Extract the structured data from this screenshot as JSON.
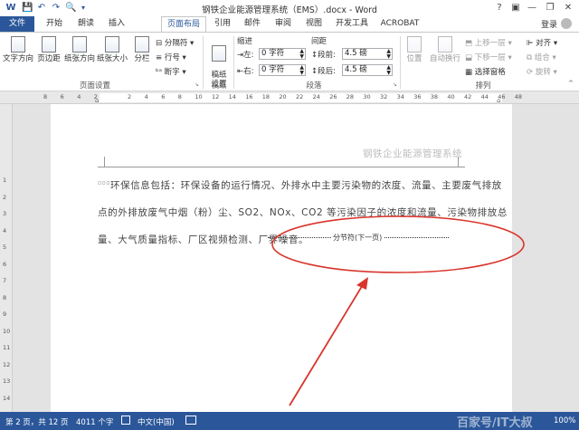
{
  "window": {
    "title": "钢铁企业能源管理系统（EMS）.docx - Word",
    "help": "?",
    "minimize": "—",
    "restore": "❐",
    "close": "✕"
  },
  "tabs": [
    "文件",
    "开始",
    "朗读",
    "插入",
    "页面布局",
    "引用",
    "邮件",
    "审阅",
    "视图",
    "开发工具",
    "ACROBAT"
  ],
  "active_tab": "页面布局",
  "account": {
    "login": "登录"
  },
  "ribbon": {
    "page_setup": {
      "label": "页面设置",
      "text_direction": "文字方向",
      "margins": "页边距",
      "orientation": "纸张方向",
      "size": "纸张大小",
      "columns": "分栏",
      "breaks": "分隔符",
      "line_numbers": "行号",
      "hyphenation": "断字"
    },
    "draft": {
      "label": "稿纸",
      "button": "稿纸\n设置"
    },
    "paragraph": {
      "label": "段落",
      "indent_header": "缩进",
      "spacing_header": "间距",
      "left_label": "左:",
      "left_value": "0 字符",
      "right_label": "右:",
      "right_value": "0 字符",
      "before_label": "段前:",
      "before_value": "4.5 磅",
      "after_label": "段后:",
      "after_value": "4.5 磅"
    },
    "arrange": {
      "label": "排列",
      "position": "位置",
      "wrap_text": "自动换行",
      "bring_forward": "上移一层",
      "send_backward": "下移一层",
      "selection_pane": "选择窗格",
      "align": "对齐",
      "group": "组合",
      "rotate": "旋转"
    }
  },
  "ruler": {
    "h_numbers": [
      "8",
      "6",
      "4",
      "2",
      "",
      "2",
      "4",
      "6",
      "8",
      "10",
      "12",
      "14",
      "16",
      "18",
      "20",
      "22",
      "24",
      "26",
      "28",
      "30",
      "32",
      "34",
      "36",
      "38",
      "40",
      "42",
      "44",
      "46",
      "48"
    ],
    "v_numbers": [
      "1",
      "2",
      "3",
      "4",
      "5",
      "6",
      "7",
      "8",
      "9",
      "10",
      "11",
      "12",
      "13",
      "14"
    ]
  },
  "document": {
    "header": "钢铁企业能源管理系统",
    "lines": [
      "环保信息包括：环保设备的运行情况、外排水中主要污染物的浓度、流量、主要废气排放",
      "点的外排放废气中烟（粉）尘、SO2、NOx、CO2 等污染因子的浓度和流量、污染物排放总",
      "量、大气质量指标、厂区视频检测、厂界噪音。"
    ],
    "section_break": "分节符(下一页)"
  },
  "status": {
    "page": "第 2 页，共 12 页",
    "words": "4011 个字",
    "language": "中文(中国)",
    "zoom": "100%"
  },
  "watermark": "百家号/IT大叔"
}
